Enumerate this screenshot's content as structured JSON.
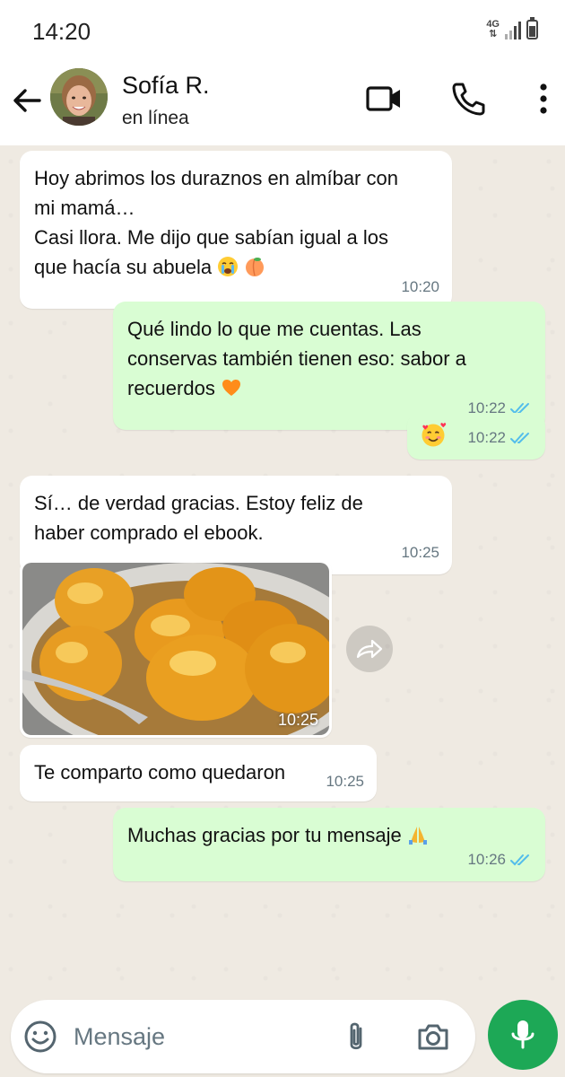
{
  "status_bar": {
    "time": "14:20",
    "network": "4G"
  },
  "header": {
    "contact_name": "Sofía R.",
    "contact_status": "en línea"
  },
  "messages": [
    {
      "direction": "incoming",
      "lines": [
        "Hoy abrimos los duraznos en almíbar con",
        "mi mamá…",
        "Casi llora. Me dijo que sabían igual a los",
        "que hacía su abuela"
      ],
      "time": "10:20",
      "emojis": [
        "crying-face",
        "peach"
      ]
    },
    {
      "direction": "outgoing",
      "lines": [
        "Qué lindo lo que me cuentas. Las",
        "conservas también tienen eso: sabor a",
        "recuerdos"
      ],
      "time": "10:22",
      "emojis": [
        "orange-heart"
      ]
    },
    {
      "direction": "outgoing",
      "time": "10:22",
      "emojis": [
        "smiling-face-with-hearts"
      ]
    },
    {
      "direction": "incoming",
      "lines": [
        "Sí… de verdad gracias. Estoy feliz de",
        "haber comprado el ebook."
      ],
      "time": "10:25"
    },
    {
      "direction": "incoming",
      "type": "image",
      "image": "peaches-in-syrup-bowl",
      "time": "10:25"
    },
    {
      "direction": "incoming",
      "lines": [
        "Te comparto como quedaron"
      ],
      "time": "10:25"
    },
    {
      "direction": "outgoing",
      "lines": [
        "Muchas gracias por tu mensaje"
      ],
      "time": "10:26",
      "emojis": [
        "folded-hands"
      ]
    }
  ],
  "input": {
    "placeholder": "Mensaje"
  },
  "colors": {
    "outgoing_bubble": "#d9fdd3",
    "incoming_bubble": "#ffffff",
    "chat_background": "#efeae2",
    "accent_green": "#1da856",
    "read_ticks": "#53bdeb"
  },
  "icons": [
    "back-arrow-icon",
    "video-call-icon",
    "phone-call-icon",
    "more-options-icon",
    "emoji-icon",
    "attach-icon",
    "camera-icon",
    "mic-icon",
    "forward-icon",
    "double-check-icon"
  ]
}
